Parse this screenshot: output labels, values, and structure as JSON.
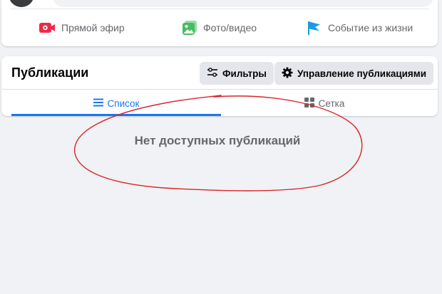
{
  "composer": {
    "actions": [
      {
        "label": "Прямой эфир",
        "icon": "live-video-icon",
        "color": "#f02849"
      },
      {
        "label": "Фото/видео",
        "icon": "photo-video-icon",
        "color": "#45bd62"
      },
      {
        "label": "Событие из жизни",
        "icon": "life-event-flag-icon",
        "color": "#1b9ae6"
      }
    ]
  },
  "posts": {
    "title": "Публикации",
    "filters_label": "Фильтры",
    "manage_label": "Управление публикациями",
    "tabs": [
      {
        "label": "Список",
        "icon": "list-icon",
        "active": true
      },
      {
        "label": "Сетка",
        "icon": "grid-icon",
        "active": false
      }
    ],
    "empty_message": "Нет доступных публикаций"
  },
  "colors": {
    "accent": "#1877f2",
    "background": "#f0f2f5",
    "annotation_ink": "#d9252b"
  }
}
